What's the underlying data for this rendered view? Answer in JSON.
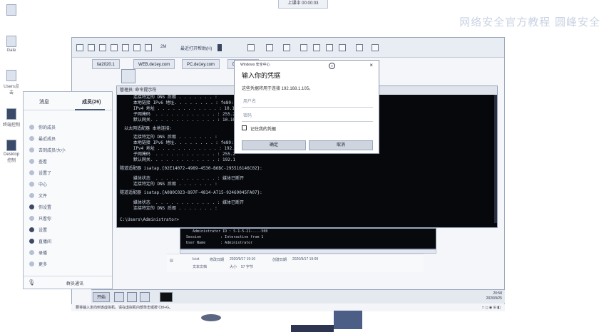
{
  "recording": {
    "label": "上课中 00:00:03"
  },
  "brand": {
    "text": "网络安全官方教程 圆峰安全"
  },
  "desktop_icons": [
    {
      "label": ""
    },
    {
      "label": "Gate"
    },
    {
      "label": "Users点击"
    },
    {
      "label": "终端控制"
    },
    {
      "label": "Desktop控制"
    }
  ],
  "vm_toolbar": {
    "items": [
      "2M",
      "最近打开",
      "帮助(H)"
    ]
  },
  "tabs": [
    "fal2020.1",
    "WEB.de1ey.com",
    "PC.de1ey.com",
    "Dx1ey.com"
  ],
  "sidepanel": {
    "tab_inactive": "消息",
    "tab_active": "成员(26)",
    "items": [
      {
        "label": "你的成员",
        "dark": false
      },
      {
        "label": "最近成员",
        "dark": false
      },
      {
        "label": "去到成员/大小",
        "dark": false
      },
      {
        "label": "查看",
        "dark": false
      },
      {
        "label": "设置了",
        "dark": false
      },
      {
        "label": "中心",
        "dark": false
      },
      {
        "label": "文件",
        "dark": false
      },
      {
        "label": "你设置",
        "dark": true
      },
      {
        "label": "只看你",
        "dark": false
      },
      {
        "label": "设置",
        "dark": true
      },
      {
        "label": "直播间",
        "dark": true
      },
      {
        "label": "录播",
        "dark": false
      },
      {
        "label": "更多",
        "dark": false
      }
    ],
    "footer_left": "",
    "footer_right": "群员通讯"
  },
  "console": {
    "title": "管理员: 命令提示符",
    "lines": [
      "   连接特定的 DNS 后缀 . . . . . . . :",
      "   本地链接 IPv6 地址. . . . . . . . : fe80::",
      "   IPv4 地址 . . . . . . . . . . . . : 10.10",
      "   子网掩码  . . . . . . . . . . . . : 255.2",
      "   默认网关. . . . . . . . . . . . . : 10.10",
      "",
      "以太网适配器 本地连接:",
      "",
      "   连接特定的 DNS 后缀 . . . . . . . :",
      "   本地链接 IPv6 地址. . . . . . . . : fe80::",
      "   IPv4 地址 . . . . . . . . . . . . : 192.1",
      "   子网掩码  . . . . . . . . . . . . : 255.2",
      "   默认网关. . . . . . . . . . . . . : 192.1",
      "",
      "隧道适配器 isatap.{02E14072-4989-4530-B6BC-295516146C02}:",
      "",
      "   媒体状态  . . . . . . . . . . . . : 媒体已断开",
      "   连接特定的 DNS 后缀 . . . . . . . :",
      "",
      "隧道适配器 isatap.{A080C023-897F-4814-A715-92469045FA07}:",
      "",
      "   媒体状态  . . . . . . . . . . . . : 媒体已断开",
      "   连接特定的 DNS 后缀 . . . . . . . :",
      "",
      "C:\\Users\\Administrator>"
    ]
  },
  "dialog": {
    "titlebar": "Windows 安全中心",
    "close": "×",
    "heading": "输入你的凭据",
    "desc": "这些凭据将用于连接 192.168.1.105。",
    "username_placeholder": "用户名",
    "password_placeholder": "密码",
    "remember": "记住我的凭据",
    "ok": "确定",
    "cancel": "取消"
  },
  "console2": {
    "lines": [
      "   Administrator ID : S-1-5-21-...-500",
      "Session         : Interactive from 1",
      "User Name       : Administrator"
    ]
  },
  "filerow": {
    "name": "b.txt",
    "modified_label": "修改日期",
    "modified": "2020/9/17 19:10",
    "created_label": "创建日期",
    "created": "2020/9/17 19:09",
    "type": "文本文档",
    "size_label": "大小",
    "size": "57 字节"
  },
  "taskbar": {
    "start": "开始",
    "time": "20:58",
    "date": "2020/9/25"
  },
  "statusbar": {
    "text": "要将输入定向到该虚拟机，请在虚拟机内部单击或按 Ctrl+G。",
    "right": "□ ◻ ◉ ⊞ ◧"
  }
}
